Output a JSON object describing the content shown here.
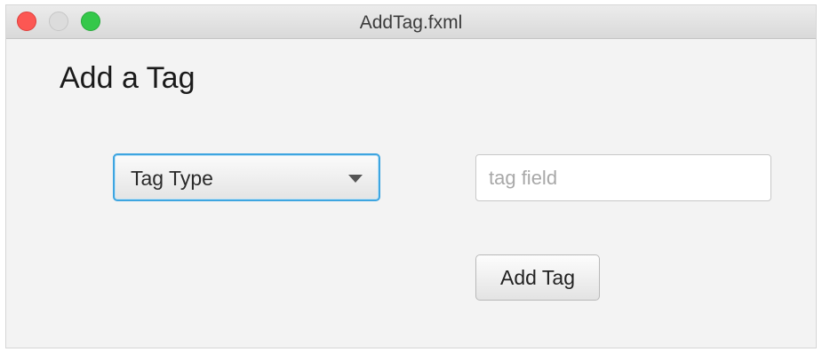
{
  "window": {
    "title": "AddTag.fxml",
    "controls": [
      "close-icon",
      "minimize-icon",
      "maximize-icon"
    ],
    "colors": {
      "close": "#fc5753",
      "minimize": "#dcdcdc",
      "maximize": "#34c84a"
    }
  },
  "page": {
    "heading": "Add a Tag"
  },
  "form": {
    "tag_type": {
      "selected": "Tag Type"
    },
    "tag_field": {
      "value": "",
      "placeholder": "tag field"
    },
    "add_button_label": "Add Tag"
  },
  "colors": {
    "focus_accent": "#3ea5e0",
    "background": "#f3f3f3"
  }
}
